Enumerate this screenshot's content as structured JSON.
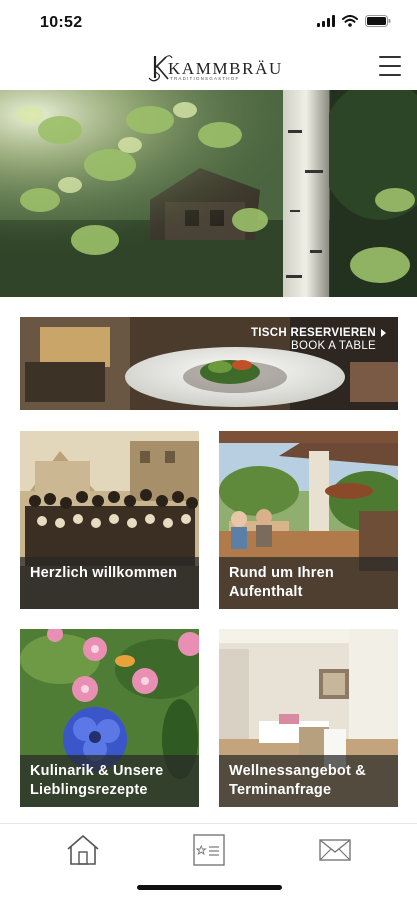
{
  "status_bar": {
    "time": "10:52",
    "icons": [
      "signal-icon",
      "wifi-icon",
      "battery-icon"
    ]
  },
  "header": {
    "logo_text": "KAMMBRÄU",
    "logo_tagline": "TRADITIONSGASTHOF",
    "menu_icon": "hamburger-menu-icon"
  },
  "hero": {
    "image": "birch-tree-forest-chalet-photo"
  },
  "reservation_banner": {
    "line1": "TISCH RESERVIEREN",
    "line2": "BOOK A TABLE",
    "arrow_icon": "triangle-right-icon",
    "image": "plated-dish-photo"
  },
  "tiles": [
    {
      "label": "Herzlich willkommen",
      "image": "historic-group-photo"
    },
    {
      "label": "Rund um Ihren Aufenthalt",
      "image": "garden-terrace-photo"
    },
    {
      "label": "Kulinarik & Unsere Lieblingsrezepte",
      "image": "meadow-flowers-photo"
    },
    {
      "label": "Wellnessangebot & Terminanfrage",
      "image": "wellness-room-photo"
    }
  ],
  "tabbar": {
    "items": [
      {
        "name": "home",
        "icon": "home-icon"
      },
      {
        "name": "card",
        "icon": "id-card-icon"
      },
      {
        "name": "mail",
        "icon": "envelope-icon"
      }
    ]
  },
  "colors": {
    "caption_overlay": "#2a2a2a",
    "banner_text": "#ffffff",
    "icon_stroke": "#555555"
  }
}
